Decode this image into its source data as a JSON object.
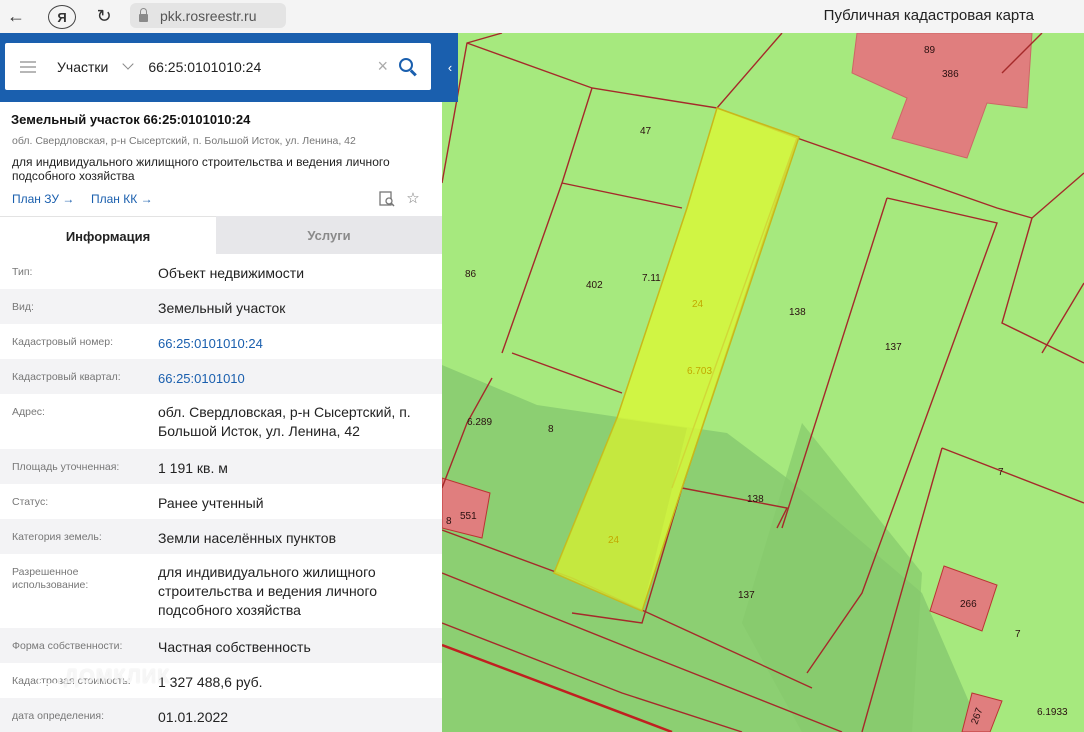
{
  "browser": {
    "url": "pkk.rosreestr.ru",
    "page_title": "Публичная кадастровая карта",
    "yandex_icon": "Я"
  },
  "search": {
    "category": "Участки",
    "value": "66:25:0101010:24"
  },
  "object": {
    "title": "Земельный участок 66:25:0101010:24",
    "address_short": "обл. Свердловская, р-н Сысертский, п. Большой Исток, ул. Ленина, 42",
    "use_line": "для индивидуального жилищного строительства и ведения личного подсобного хозяйства",
    "plan_zu": "План ЗУ →",
    "plan_kk": "План КК →"
  },
  "tabs": {
    "info": "Информация",
    "services": "Услуги"
  },
  "info_rows": [
    {
      "label": "Тип:",
      "value": "Объект недвижимости"
    },
    {
      "label": "Вид:",
      "value": "Земельный участок"
    },
    {
      "label": "Кадастровый номер:",
      "value": "66:25:0101010:24"
    },
    {
      "label": "Кадастровый квартал:",
      "value": "66:25:0101010"
    },
    {
      "label": "Адрес:",
      "value": "обл. Свердловская, р-н Сысертский, п. Большой Исток, ул. Ленина, 42"
    },
    {
      "label": "Площадь уточненная:",
      "value": "1 191 кв. м"
    },
    {
      "label": "Статус:",
      "value": "Ранее учтенный"
    },
    {
      "label": "Категория земель:",
      "value": "Земли населённых пунктов"
    },
    {
      "label": "Разрешенное использование:",
      "value": "для индивидуального жилищного строительства и ведения личного подсобного хозяйства"
    },
    {
      "label": "Форма собственности:",
      "value": "Частная собственность"
    },
    {
      "label": "Кадастровая стоимость:",
      "value": "1 327 488,6 руб."
    },
    {
      "label": "дата определения:",
      "value": "01.01.2022"
    }
  ],
  "watermark": "ДОМКЛИК",
  "map_labels": {
    "p89": "89",
    "p386": "386",
    "p47": "47",
    "p86": "86",
    "p402": "402",
    "p711": "7.11",
    "p24a": "24",
    "p138a": "138",
    "p137a": "137",
    "p6703": "6.703",
    "p6289": "6.289",
    "p8a": "8",
    "p551": "551",
    "p8b": "8",
    "p138b": "138",
    "p24b": "24",
    "p7a": "7",
    "p137b": "137",
    "p266": "266",
    "p7b": "7",
    "p267": "267",
    "p61933": "6.1933"
  },
  "colors": {
    "accent": "#1a5fae",
    "parcel_fill": "#a6e97e",
    "parcel_border": "#a52a2a",
    "selected_parcel": "#d7f73a",
    "building": "#e07e7e"
  }
}
